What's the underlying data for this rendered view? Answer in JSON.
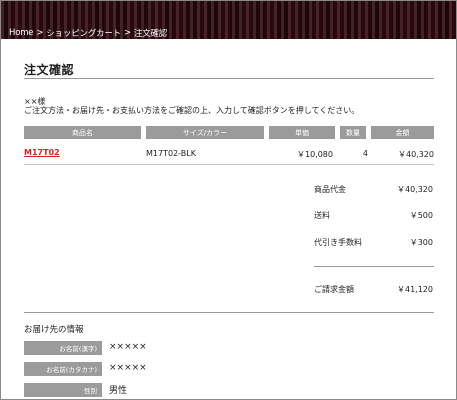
{
  "breadcrumb": {
    "home": "Home",
    "separator": ">",
    "cart": "ショッピングカート",
    "current": "注文確認"
  },
  "page": {
    "title": "注文確認",
    "greeting": "××様",
    "instruction": "ご注文方法・お届け先・お支払い方法をご確認の上、入力して確認ボタンを押してください。"
  },
  "order_table": {
    "headers": [
      "商品名",
      "サイズ/カラー",
      "単価",
      "数量",
      "金額"
    ],
    "rows": [
      {
        "product": "M17T02",
        "size_color": "M17T02-BLK",
        "unit_price": "￥10,080",
        "quantity": "4",
        "amount": "￥40,320"
      }
    ]
  },
  "summary": {
    "subtotal_label": "商品代金",
    "subtotal_value": "￥40,320",
    "shipping_label": "送料",
    "shipping_value": "￥500",
    "cod_label": "代引き手数料",
    "cod_value": "￥300",
    "total_label": "ご請求金額",
    "total_value": "￥41,120"
  },
  "shipping_info": {
    "heading": "お届け先の情報",
    "fields": [
      {
        "label": "お名前(漢字)",
        "value": "×××××"
      },
      {
        "label": "お名前(カタカナ)",
        "value": "×××××"
      },
      {
        "label": "性別",
        "value": "男性"
      }
    ]
  }
}
